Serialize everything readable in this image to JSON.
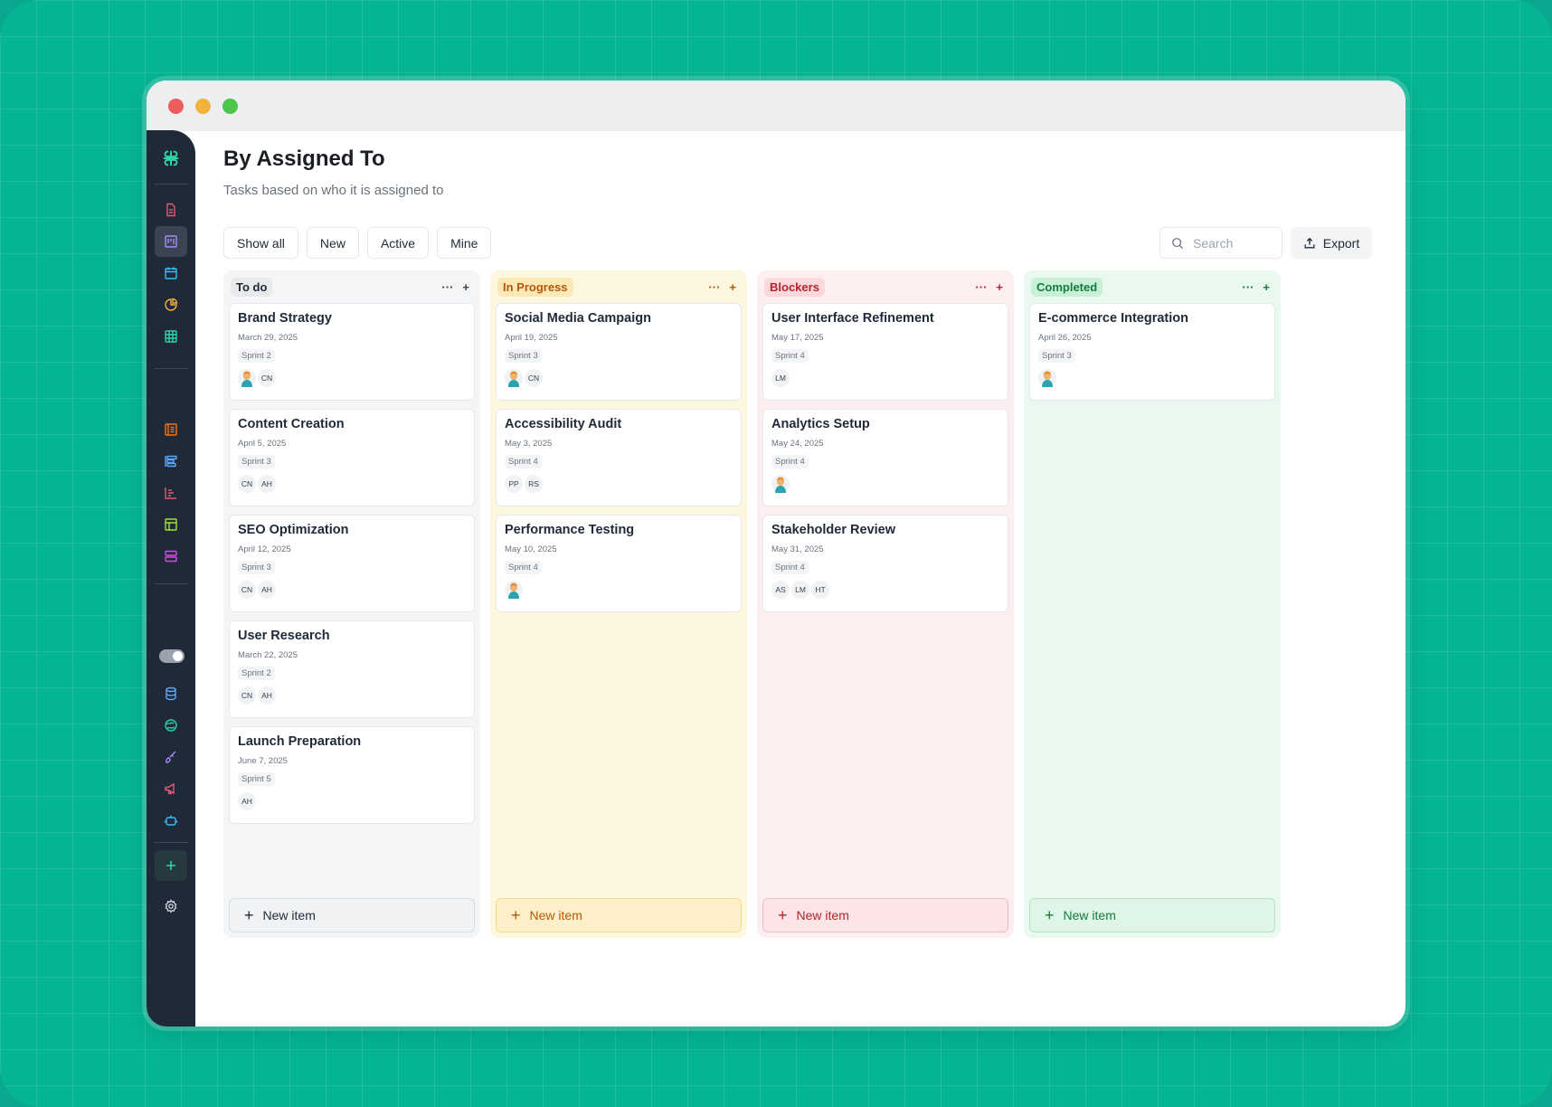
{
  "page": {
    "title": "By Assigned To",
    "subtitle": "Tasks based on who it is assigned to"
  },
  "filters": [
    "Show all",
    "New",
    "Active",
    "Mine"
  ],
  "search": {
    "placeholder": "Search"
  },
  "export_label": "Export",
  "sidebar": {
    "logo": "app-logo-icon",
    "icons": [
      "document-icon",
      "board-icon",
      "calendar-icon",
      "pie-chart-icon",
      "table-icon",
      "list-icon",
      "rows-icon",
      "bar-chart-icon",
      "grid-icon",
      "stack-icon",
      "database-icon",
      "globe-icon",
      "brush-icon",
      "megaphone-icon",
      "bot-icon",
      "plus-icon",
      "gear-icon"
    ]
  },
  "columns": [
    {
      "name": "To do",
      "accent": "#1f2937",
      "new_item_label": "New item",
      "cards": [
        {
          "title": "Brand Strategy",
          "date": "March 29, 2025",
          "sprint": "Sprint 2",
          "assignees": [
            "avatar-photo",
            "CN"
          ]
        },
        {
          "title": "Content Creation",
          "date": "April 5, 2025",
          "sprint": "Sprint 3",
          "assignees": [
            "CN",
            "AH"
          ]
        },
        {
          "title": "SEO Optimization",
          "date": "April 12, 2025",
          "sprint": "Sprint 3",
          "assignees": [
            "CN",
            "AH"
          ]
        },
        {
          "title": "User Research",
          "date": "March 22, 2025",
          "sprint": "Sprint 2",
          "assignees": [
            "CN",
            "AH"
          ]
        },
        {
          "title": "Launch Preparation",
          "date": "June 7, 2025",
          "sprint": "Sprint 5",
          "assignees": [
            "AH"
          ]
        }
      ]
    },
    {
      "name": "In Progress",
      "accent": "#b4580b",
      "new_item_label": "New item",
      "cards": [
        {
          "title": "Social Media Campaign",
          "date": "April 19, 2025",
          "sprint": "Sprint 3",
          "assignees": [
            "avatar-photo",
            "CN"
          ]
        },
        {
          "title": "Accessibility Audit",
          "date": "May 3, 2025",
          "sprint": "Sprint 4",
          "assignees": [
            "PP",
            "RS"
          ]
        },
        {
          "title": "Performance Testing",
          "date": "May 10, 2025",
          "sprint": "Sprint 4",
          "assignees": [
            "avatar-photo"
          ]
        }
      ]
    },
    {
      "name": "Blockers",
      "accent": "#b4242f",
      "new_item_label": "New item",
      "cards": [
        {
          "title": "User Interface Refinement",
          "date": "May 17, 2025",
          "sprint": "Sprint 4",
          "assignees": [
            "LM"
          ]
        },
        {
          "title": "Analytics Setup",
          "date": "May 24, 2025",
          "sprint": "Sprint 4",
          "assignees": [
            "avatar-photo"
          ]
        },
        {
          "title": "Stakeholder Review",
          "date": "May 31, 2025",
          "sprint": "Sprint 4",
          "assignees": [
            "AS",
            "LM",
            "HT"
          ]
        }
      ]
    },
    {
      "name": "Completed",
      "accent": "#137b3e",
      "new_item_label": "New item",
      "cards": [
        {
          "title": "E-commerce Integration",
          "date": "April 26, 2025",
          "sprint": "Sprint 3",
          "assignees": [
            "avatar-photo"
          ]
        }
      ]
    }
  ]
}
